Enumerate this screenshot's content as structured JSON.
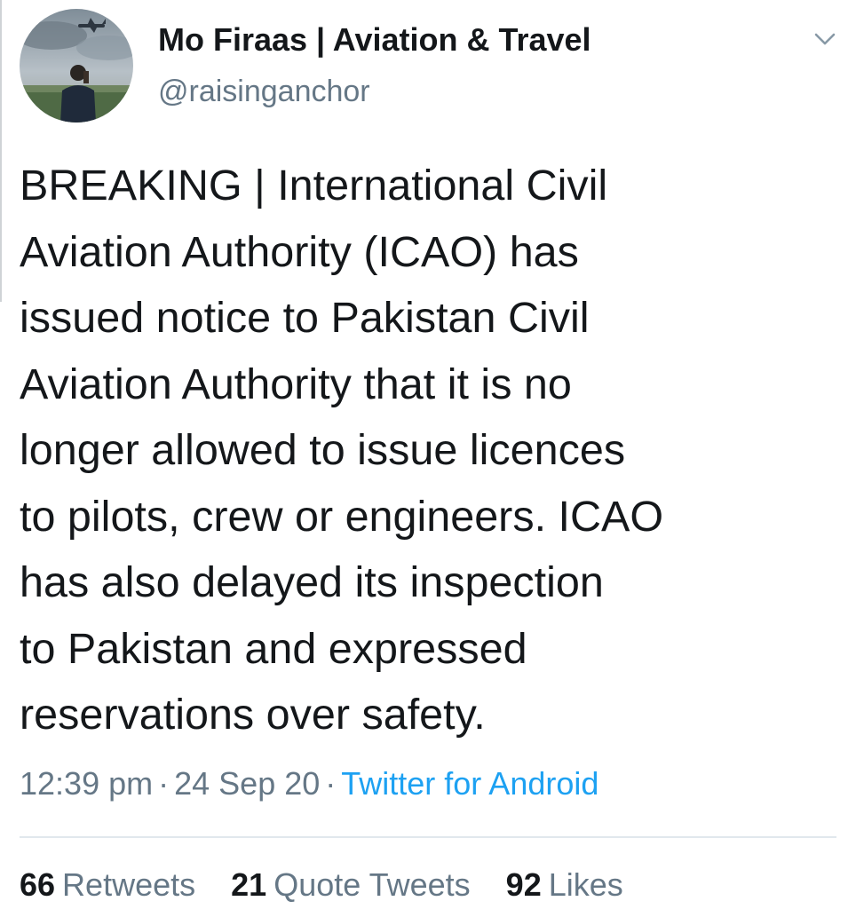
{
  "tweet": {
    "author": {
      "name": "Mo Firaas | Aviation & Travel",
      "handle": "@raisinganchor"
    },
    "text": "BREAKING | International Civil\nAviation Authority (ICAO) has\nissued notice to Pakistan Civil\nAviation Authority that it is no\nlonger allowed to issue licences\nto pilots, crew or engineers. ICAO\nhas also delayed its inspection\nto Pakistan and expressed\nreservations over safety.",
    "time": "12:39 pm",
    "date": "24 Sep 20",
    "separator": "·",
    "source": "Twitter for Android",
    "stats": {
      "retweets_count": "66",
      "retweets_label": "Retweets",
      "quotes_count": "21",
      "quotes_label": "Quote Tweets",
      "likes_count": "92",
      "likes_label": "Likes"
    }
  },
  "colors": {
    "text_primary": "#14171a",
    "text_secondary": "#657786",
    "link": "#1da1f2",
    "divider": "#e1e8ed"
  },
  "icons": {
    "menu": "chevron-down-icon",
    "avatar": "avatar-photo"
  }
}
